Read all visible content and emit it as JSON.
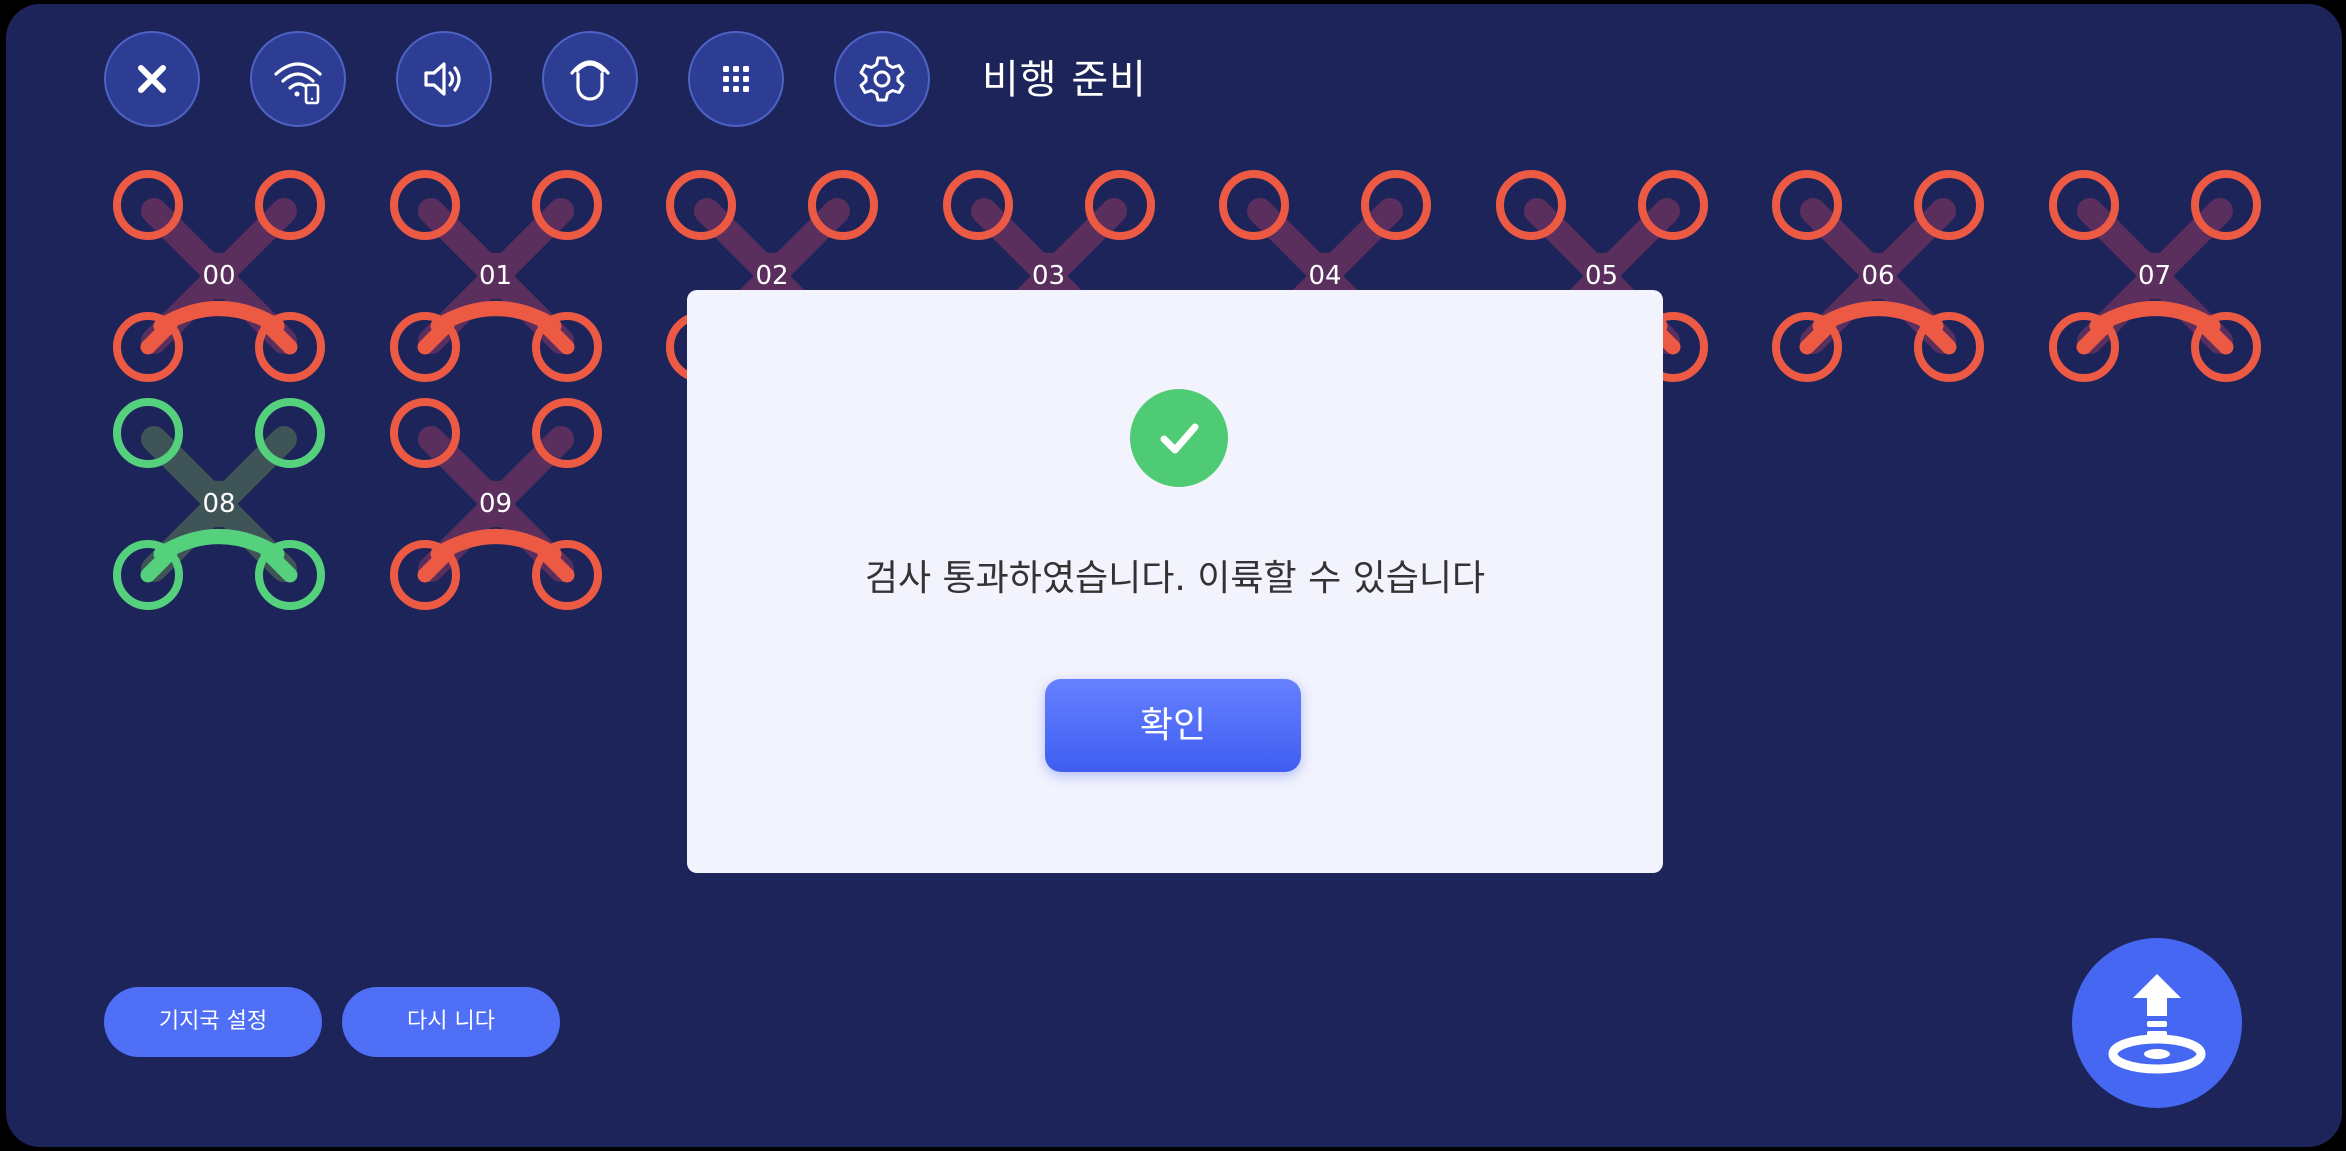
{
  "header": {
    "title": "비행 준비",
    "icons": [
      "close-icon",
      "wifi-phone-icon",
      "speaker-icon",
      "magnet-icon",
      "grid-icon",
      "gear-icon"
    ]
  },
  "drones": [
    {
      "id": "00",
      "status": "error"
    },
    {
      "id": "01",
      "status": "error"
    },
    {
      "id": "02",
      "status": "error"
    },
    {
      "id": "03",
      "status": "error"
    },
    {
      "id": "04",
      "status": "error"
    },
    {
      "id": "05",
      "status": "error"
    },
    {
      "id": "06",
      "status": "error"
    },
    {
      "id": "07",
      "status": "error"
    },
    {
      "id": "08",
      "status": "ok"
    },
    {
      "id": "09",
      "status": "error"
    }
  ],
  "colors": {
    "background": "#1d2459",
    "error": "#ec5a44",
    "ok": "#55d17d",
    "accent": "#4e6ff6",
    "dialog": "#f2f3fc"
  },
  "dialog": {
    "icon": "check-circle-icon",
    "message": "검사 통과하였습니다. 이륙할 수 있습니다",
    "confirm_label": "확인"
  },
  "footer": {
    "base_station_label": "기지국 설정",
    "retry_label": "다시 니다",
    "takeoff_icon": "takeoff-icon"
  }
}
